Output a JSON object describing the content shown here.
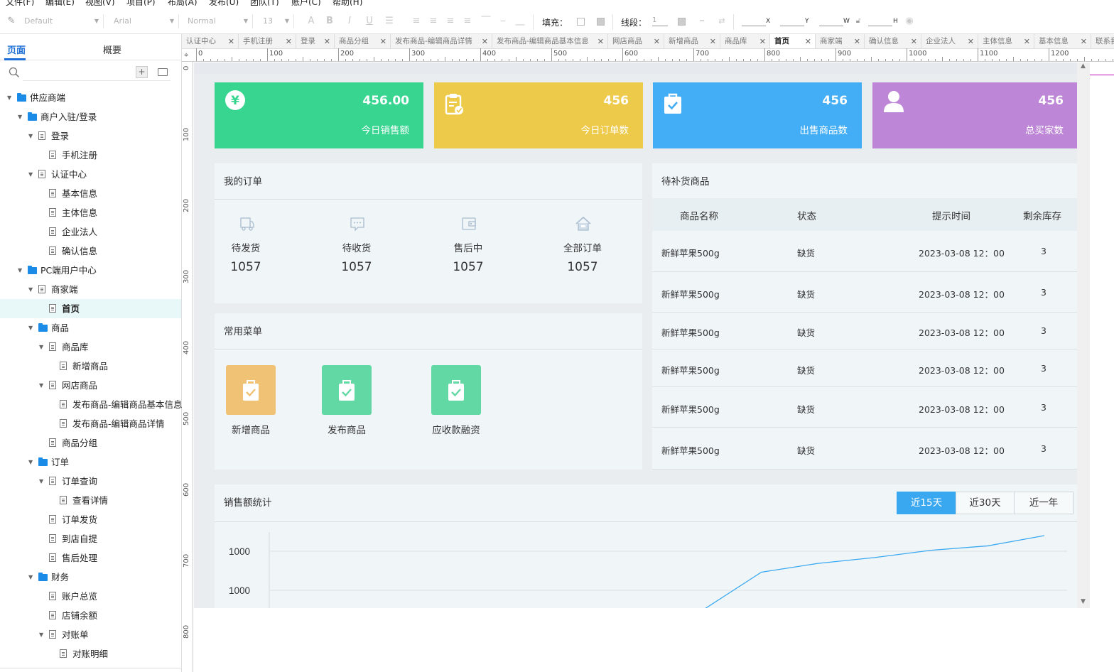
{
  "menubar": [
    "文件(F)",
    "编辑(E)",
    "视图(V)",
    "项目(P)",
    "布局(A)",
    "发布(U)",
    "团队(T)",
    "账户(C)",
    "帮助(H)"
  ],
  "toolbar": {
    "style_select": "Default",
    "font_select": "Arial",
    "weight_select": "Normal",
    "size_select": "13",
    "fill_label": "填充：",
    "stroke_label": "线段：",
    "stroke_value": "1",
    "x_label": "X",
    "y_label": "Y",
    "w_label": "W",
    "h_label": "H"
  },
  "left_panel": {
    "tab_pages": "页面",
    "tab_overview": "概要",
    "tree": [
      {
        "label": "供应商端",
        "depth": 0,
        "kind": "folder",
        "expanded": true
      },
      {
        "label": "商户入驻/登录",
        "depth": 1,
        "kind": "folder",
        "expanded": true
      },
      {
        "label": "登录",
        "depth": 2,
        "kind": "page",
        "expanded": true
      },
      {
        "label": "手机注册",
        "depth": 3,
        "kind": "page"
      },
      {
        "label": "认证中心",
        "depth": 2,
        "kind": "page",
        "expanded": true
      },
      {
        "label": "基本信息",
        "depth": 3,
        "kind": "page"
      },
      {
        "label": "主体信息",
        "depth": 3,
        "kind": "page"
      },
      {
        "label": "企业法人",
        "depth": 3,
        "kind": "page"
      },
      {
        "label": "确认信息",
        "depth": 3,
        "kind": "page"
      },
      {
        "label": "PC端用户中心",
        "depth": 1,
        "kind": "folder",
        "expanded": true
      },
      {
        "label": "商家端",
        "depth": 2,
        "kind": "page",
        "expanded": true
      },
      {
        "label": "首页",
        "depth": 3,
        "kind": "page",
        "selected": true
      },
      {
        "label": "商品",
        "depth": 2,
        "kind": "folder",
        "expanded": true
      },
      {
        "label": "商品库",
        "depth": 3,
        "kind": "page",
        "expanded": true
      },
      {
        "label": "新增商品",
        "depth": 4,
        "kind": "page"
      },
      {
        "label": "网店商品",
        "depth": 3,
        "kind": "page",
        "expanded": true
      },
      {
        "label": "发布商品-编辑商品基本信息",
        "depth": 4,
        "kind": "page"
      },
      {
        "label": "发布商品-编辑商品详情",
        "depth": 4,
        "kind": "page"
      },
      {
        "label": "商品分组",
        "depth": 3,
        "kind": "page"
      },
      {
        "label": "订单",
        "depth": 2,
        "kind": "folder",
        "expanded": true
      },
      {
        "label": "订单查询",
        "depth": 3,
        "kind": "page",
        "expanded": true
      },
      {
        "label": "查看详情",
        "depth": 4,
        "kind": "page"
      },
      {
        "label": "订单发货",
        "depth": 3,
        "kind": "page"
      },
      {
        "label": "到店自提",
        "depth": 3,
        "kind": "page"
      },
      {
        "label": "售后处理",
        "depth": 3,
        "kind": "page"
      },
      {
        "label": "财务",
        "depth": 2,
        "kind": "folder",
        "expanded": true
      },
      {
        "label": "账户总览",
        "depth": 3,
        "kind": "page"
      },
      {
        "label": "店铺余额",
        "depth": 3,
        "kind": "page"
      },
      {
        "label": "对账单",
        "depth": 3,
        "kind": "page",
        "expanded": true
      },
      {
        "label": "对账明细",
        "depth": 4,
        "kind": "page"
      }
    ]
  },
  "page_tabs": [
    {
      "label": "认证中心"
    },
    {
      "label": "手机注册"
    },
    {
      "label": "登录"
    },
    {
      "label": "商品分组"
    },
    {
      "label": "发布商品-编辑商品详情"
    },
    {
      "label": "发布商品-编辑商品基本信息"
    },
    {
      "label": "网店商品"
    },
    {
      "label": "新增商品"
    },
    {
      "label": "商品库"
    },
    {
      "label": "首页",
      "active": true
    },
    {
      "label": "商家端"
    },
    {
      "label": "确认信息"
    },
    {
      "label": "企业法人"
    },
    {
      "label": "主体信息"
    },
    {
      "label": "基本信息"
    },
    {
      "label": "联系我"
    }
  ],
  "ruler": {
    "h_labels": [
      "0",
      "100",
      "200",
      "300",
      "400",
      "500",
      "600",
      "700",
      "800",
      "900",
      "1000",
      "1100",
      "1200"
    ],
    "v_labels": [
      "0",
      "100",
      "200",
      "300",
      "400",
      "500",
      "600",
      "700",
      "800"
    ]
  },
  "stats": [
    {
      "value": "456.00",
      "label": "今日销售额",
      "color": "#38d591",
      "icon": "yen-icon"
    },
    {
      "value": "456",
      "label": "今日订单数",
      "color": "#eeca4b",
      "icon": "clipboard-icon"
    },
    {
      "value": "456",
      "label": "出售商品数",
      "color": "#43aef5",
      "icon": "bag-check-icon"
    },
    {
      "value": "456",
      "label": "总买家数",
      "color": "#bd86d6",
      "icon": "user-icon"
    }
  ],
  "orders": {
    "title": "我的订单",
    "items": [
      {
        "label": "待发货",
        "value": "1057",
        "icon": "truck-icon"
      },
      {
        "label": "待收货",
        "value": "1057",
        "icon": "message-icon"
      },
      {
        "label": "售后中",
        "value": "1057",
        "icon": "wallet-icon"
      },
      {
        "label": "全部订单",
        "value": "1057",
        "icon": "home-icon"
      }
    ]
  },
  "common_menu": {
    "title": "常用菜单",
    "items": [
      {
        "label": "新增商品",
        "color": "#f0c276",
        "icon": "bag-check-icon"
      },
      {
        "label": "发布商品",
        "color": "#62d9a4",
        "icon": "bag-check-icon"
      },
      {
        "label": "应收款融资",
        "color": "#62d9a4",
        "icon": "bag-check-icon"
      }
    ]
  },
  "restock": {
    "title": "待补货商品",
    "headers": [
      "商品名称",
      "状态",
      "提示时间",
      "剩余库存"
    ],
    "rows": [
      [
        "新鲜苹果500g",
        "缺货",
        "2023-03-08  12：00",
        "3"
      ],
      [
        "新鲜苹果500g",
        "缺货",
        "2023-03-08  12：00",
        "3"
      ],
      [
        "新鲜苹果500g",
        "缺货",
        "2023-03-08  12：00",
        "3"
      ],
      [
        "新鲜苹果500g",
        "缺货",
        "2023-03-08  12：00",
        "3"
      ],
      [
        "新鲜苹果500g",
        "缺货",
        "2023-03-08  12：00",
        "3"
      ],
      [
        "新鲜苹果500g",
        "缺货",
        "2023-03-08  12：00",
        "3"
      ]
    ]
  },
  "sales": {
    "title": "销售额统计",
    "ranges": [
      {
        "label": "近15天",
        "active": true
      },
      {
        "label": "近30天"
      },
      {
        "label": "近一年"
      }
    ]
  },
  "chart_data": {
    "type": "line",
    "title": "",
    "xlabel": "",
    "ylabel": "",
    "y_tick_labels": [
      "1000",
      "1000"
    ],
    "color": "#3aa8f0",
    "series": [
      {
        "values": [
          0.0,
          0.5,
          0.62,
          0.7,
          0.8,
          0.86,
          1.0
        ]
      }
    ]
  }
}
